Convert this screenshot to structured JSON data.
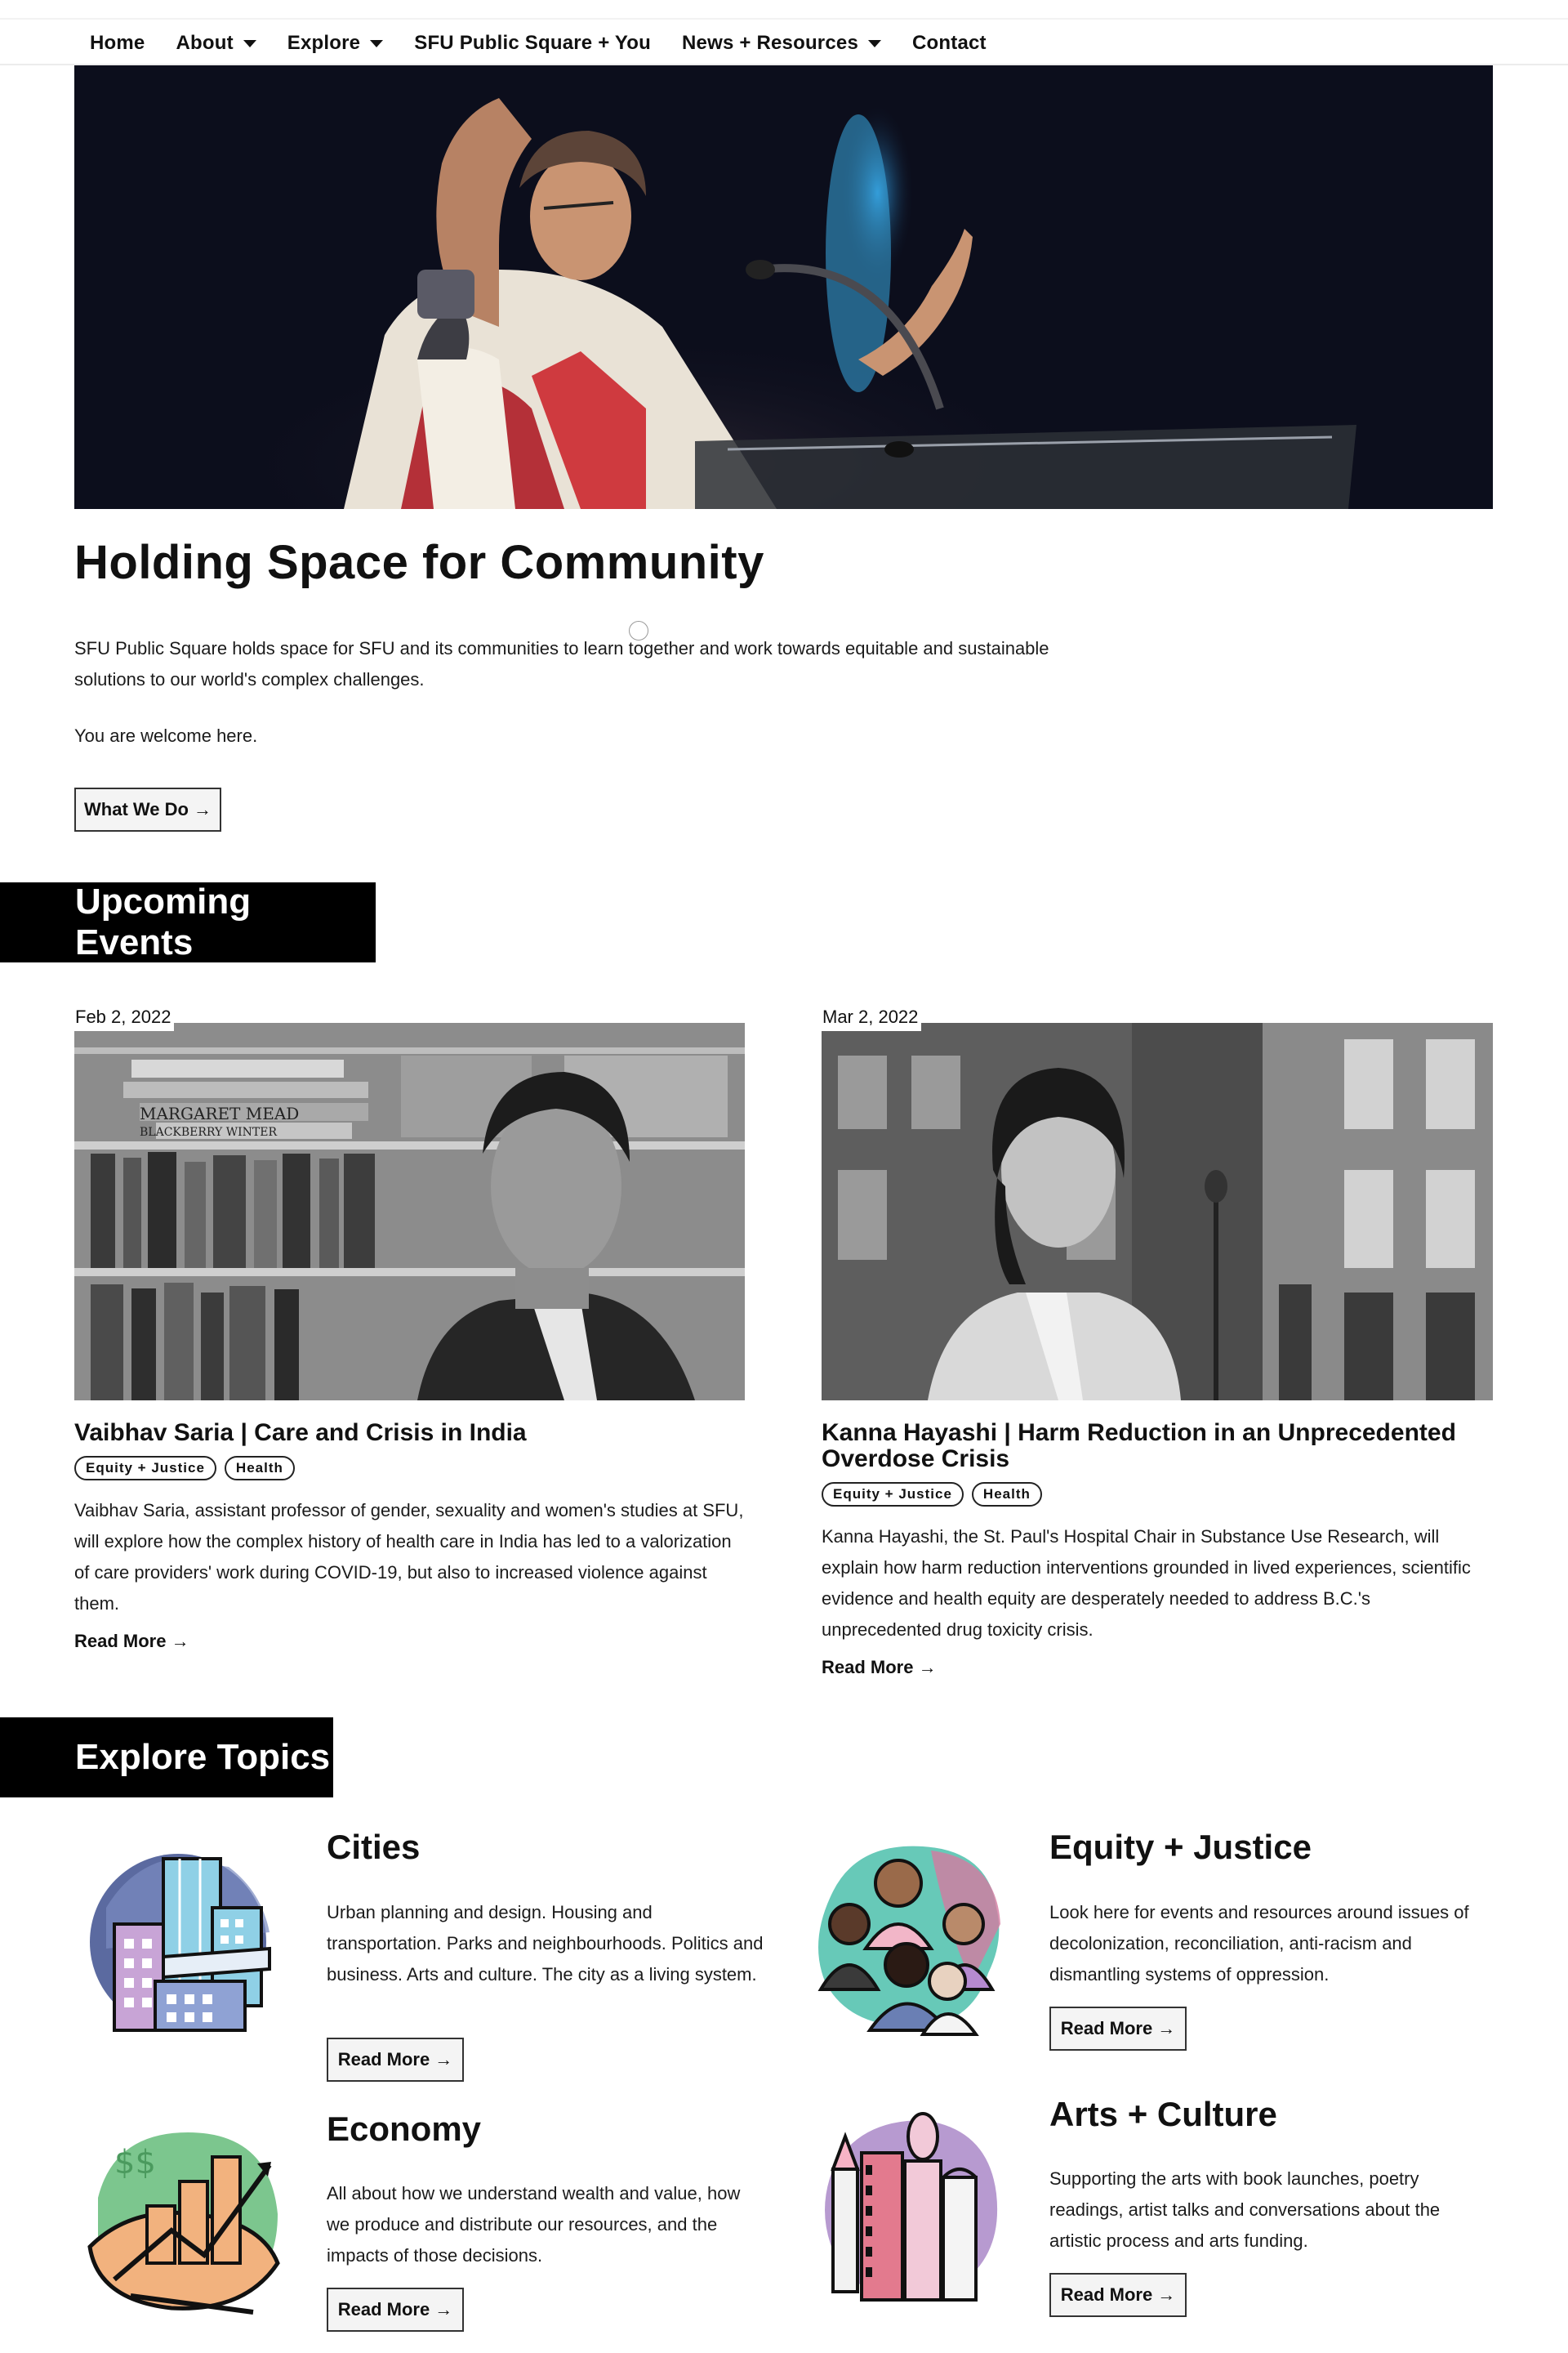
{
  "nav": {
    "items": [
      {
        "label": "Home",
        "dropdown": false
      },
      {
        "label": "About",
        "dropdown": true
      },
      {
        "label": "Explore",
        "dropdown": true
      },
      {
        "label": "SFU Public Square + You",
        "dropdown": false
      },
      {
        "label": "News + Resources",
        "dropdown": true
      },
      {
        "label": "Contact",
        "dropdown": false
      }
    ]
  },
  "hero": {
    "title": "Holding Space for Community",
    "text": "SFU Public Square holds space for SFU and its communities to learn together and work towards equitable and sustainable solutions to our world's complex challenges.",
    "welcome": "You are welcome here.",
    "button_label": "What We Do",
    "arrow": "→"
  },
  "events_section": {
    "title": "Upcoming Events",
    "events": [
      {
        "date": "Feb 2, 2022",
        "title": "Vaibhav Saria | Care and Crisis in India",
        "tags": [
          "Equity + Justice",
          "Health"
        ],
        "description": "Vaibhav Saria, assistant professor of gender, sexuality and women's studies at SFU, will explore how the complex history of health care in India has led to a valorization of care providers' work during COVID-19, but also to increased violence against them.",
        "read_more": "Read More →",
        "image_text_1": "MARGARET MEAD",
        "image_text_2": "BLACKBERRY WINTER"
      },
      {
        "date": "Mar 2, 2022",
        "title": "Kanna Hayashi | Harm Reduction in an Unprecedented Overdose Crisis",
        "tags": [
          "Equity + Justice",
          "Health"
        ],
        "description": "Kanna Hayashi, the St. Paul's Hospital Chair in Substance Use Research, will explain how harm reduction interventions grounded in lived experiences, scientific evidence and health equity are desperately needed to address B.C.'s unprecedented drug toxicity crisis.",
        "read_more": "Read More →"
      }
    ]
  },
  "topics_section": {
    "title": "Explore Topics",
    "topics": [
      {
        "title": "Cities",
        "description": "Urban planning and design. Housing and transportation. Parks and neighbourhoods. Politics and business. Arts and culture. The city as a living system.",
        "button_label": "Read More",
        "icon": "city-buildings-icon"
      },
      {
        "title": "Equity + Justice",
        "description": "Look here for events and resources around issues of decolonization, reconciliation, anti-racism and dismantling systems of oppression.",
        "button_label": "Read More",
        "icon": "people-group-icon"
      },
      {
        "title": "Economy",
        "description": "All about how we understand wealth and value, how we produce and distribute our resources, and the impacts of those decisions.",
        "button_label": "Read More",
        "icon": "economy-chart-icon"
      },
      {
        "title": "Arts + Culture",
        "description": "Supporting the arts with book launches, poetry readings, artist talks and conversations about the artistic process and arts funding.",
        "button_label": "Read More",
        "icon": "arts-instruments-icon"
      }
    ]
  },
  "colors": {
    "section_bar": "#000000",
    "button_bg": "#f4f4f4",
    "text": "#111111"
  }
}
